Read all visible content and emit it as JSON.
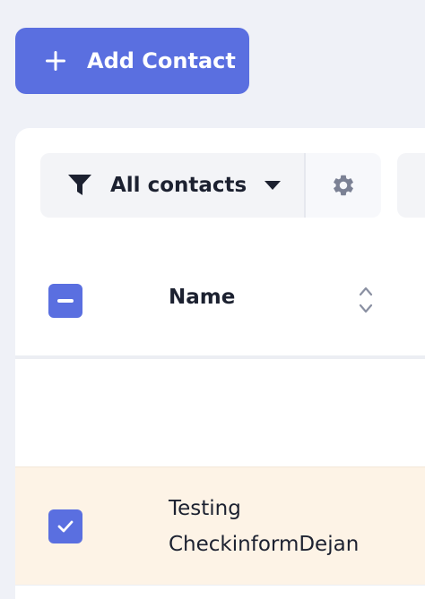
{
  "toolbar": {
    "add_contact_label": "Add Contact"
  },
  "filter": {
    "selected_label": "All contacts"
  },
  "table": {
    "columns": [
      {
        "label": "Name"
      }
    ],
    "rows": [
      {
        "name_line1": "Testing",
        "name_line2": "CheckinformDejan",
        "selected": true
      }
    ]
  },
  "colors": {
    "accent": "#5a6fe0",
    "selected_row": "#fdf3e6",
    "page_background": "#eff1f7"
  }
}
